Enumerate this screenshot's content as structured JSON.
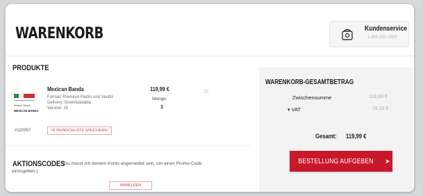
{
  "page": {
    "title": "WARENKORB"
  },
  "customer_service": {
    "label": "Kundenservice",
    "phone": "1-866-630-2689",
    "icon": "phone-icon"
  },
  "products": {
    "heading": "PRODUKTE",
    "item": {
      "name": "Mexican Banda",
      "attributes": [
        "Format: Premium Packs und Vaults!",
        "Delivery: Downloadable",
        "Version: 15"
      ],
      "sku": "#120957",
      "wishlist_label": "IN WUNSCHLISTE SPEICHERN",
      "price": "119,99 €",
      "quantity_label": "Menge:",
      "quantity": "1",
      "thumb_line1": "Nelson Music",
      "thumb_line2": "MEXICAN BANDA"
    }
  },
  "promo": {
    "heading": "AKTIONSCODES",
    "text_line1": "(Du musst mit deinem Konto angemeldet sein, um einen Promo-Code",
    "text_line2": "einzugeben.)",
    "login_label": "ANMELDEN"
  },
  "summary": {
    "heading": "WARENKORB-GESAMTBETRAG",
    "subtotal_label": "Zwischensumme",
    "subtotal_value": "119,99 €",
    "vat_label": "VAT",
    "vat_value": "19,16 €",
    "total_label": "Gesamt:",
    "total_value": "119,99 €",
    "checkout_label": "BESTELLUNG AUFGEBEN"
  },
  "colors": {
    "accent": "#c9182b",
    "link_red": "#c64545",
    "panel_bg": "#f3f3f3"
  }
}
